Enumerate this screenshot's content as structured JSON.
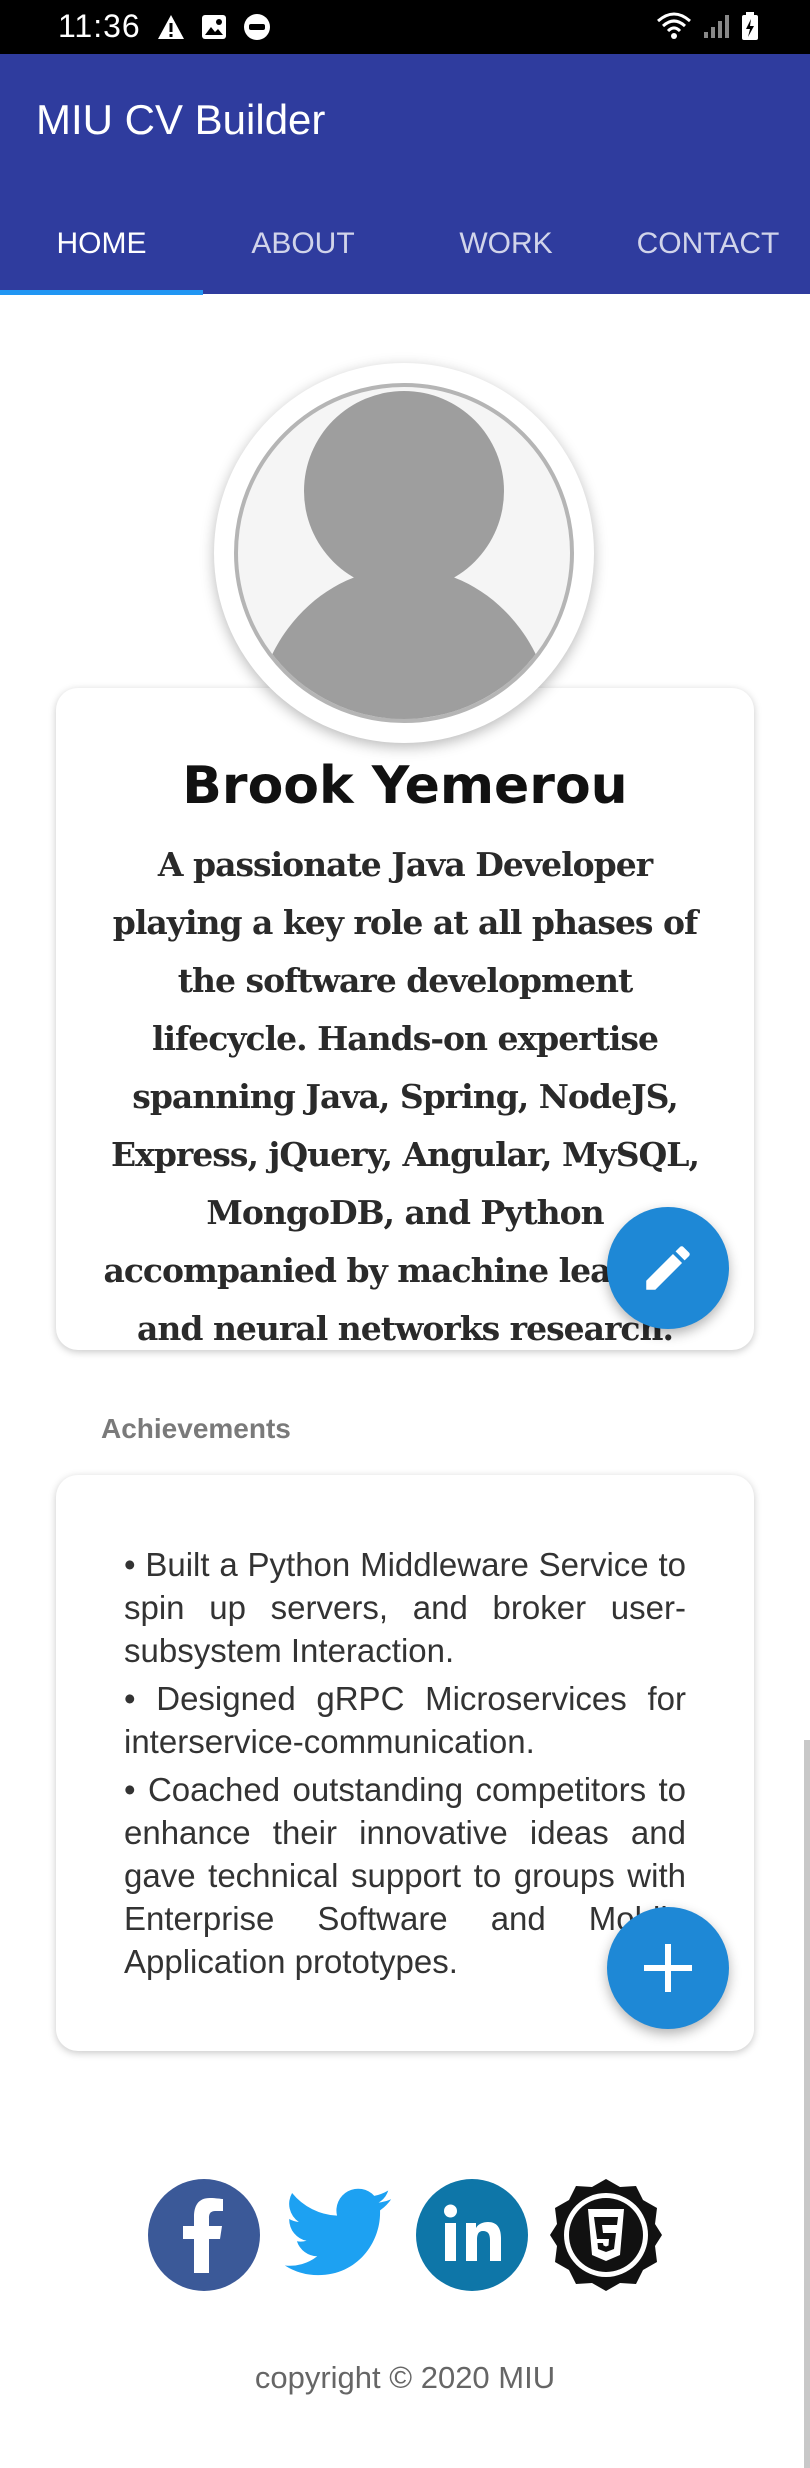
{
  "status_bar": {
    "time": "11:36"
  },
  "app": {
    "title": "MIU CV Builder"
  },
  "tabs": [
    {
      "label": "HOME"
    },
    {
      "label": "ABOUT"
    },
    {
      "label": "WORK"
    },
    {
      "label": "CONTACT"
    }
  ],
  "profile": {
    "name": "Brook Yemerou",
    "bio": "A passionate Java Developer playing a key role at all phases of the software development lifecycle. Hands-on expertise spanning Java, Spring, NodeJS, Express, jQuery, Angular, MySQL, MongoDB, and Python accompanied by machine learning and neural networks research."
  },
  "achievements": {
    "section_label": "Achievements",
    "items": [
      "• Built a Python Middleware Service to spin up servers, and broker user-subsystem Interaction.",
      "• Designed gRPC Microservices for interservice-communication.",
      "• Coached outstanding competitors to enhance their innovative ideas and gave technical support to groups with Enterprise Software and Mobile Application prototypes."
    ]
  },
  "social": [
    "facebook-icon",
    "twitter-icon",
    "linkedin-icon",
    "html5-icon"
  ],
  "footer": {
    "copyright": "copyright © 2020 MIU"
  },
  "colors": {
    "app_bar": "#2f3c9e",
    "tab_indicator": "#2196f3",
    "fab": "#1e88d6",
    "facebook": "#3b5998",
    "twitter": "#1da1f2",
    "linkedin": "#0e76a8"
  }
}
